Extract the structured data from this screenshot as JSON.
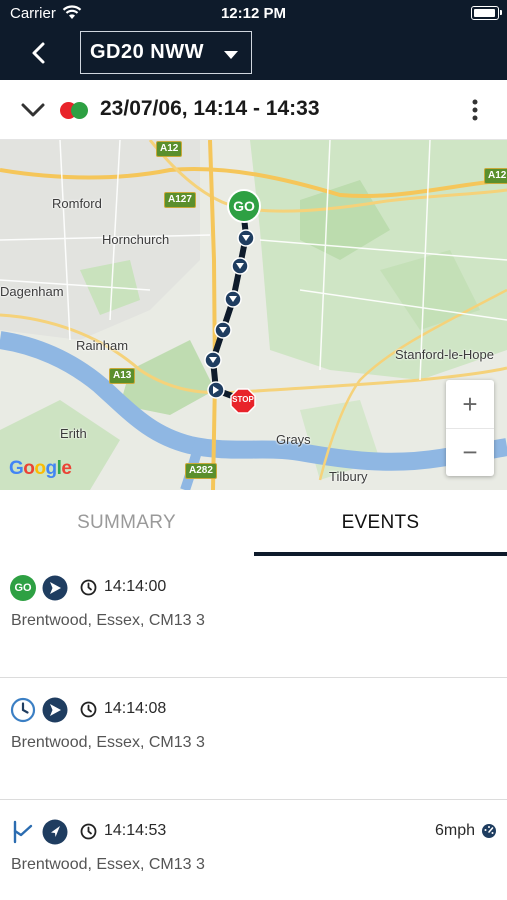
{
  "status_bar": {
    "carrier": "Carrier",
    "time": "12:12 PM"
  },
  "nav": {
    "vehicle": "GD20 NWW"
  },
  "trip": {
    "title": "23/07/06, 14:14 - 14:33"
  },
  "map": {
    "labels": {
      "romford": "Romford",
      "hornchurch": "Hornchurch",
      "dagenham": "Dagenham",
      "rainham": "Rainham",
      "erith": "Erith",
      "grays": "Grays",
      "tilbury": "Tilbury",
      "stanford": "Stanford-le-Hope"
    },
    "roads": {
      "a12": "A12",
      "a127": "A127",
      "a13": "A13",
      "a282": "A282",
      "a12_right": "A12"
    },
    "start_marker": "GO",
    "end_marker": "STOP",
    "attribution": "Google",
    "zoom_in": "+",
    "zoom_out": "−"
  },
  "tabs": {
    "summary": "SUMMARY",
    "events": "EVENTS"
  },
  "events": [
    {
      "icon1": "go-icon",
      "icon2": "heading-icon",
      "icon1_text": "GO",
      "time": "14:14:00",
      "address": "Brentwood, Essex, CM13 3",
      "speed": ""
    },
    {
      "icon1": "clock-outline-icon",
      "icon2": "heading-icon",
      "time": "14:14:08",
      "address": "Brentwood, Essex, CM13 3",
      "speed": ""
    },
    {
      "icon1": "waypoint-flag-icon",
      "icon2": "navigation-icon",
      "time": "14:14:53",
      "address": "Brentwood, Essex, CM13 3",
      "speed": "6mph"
    }
  ],
  "colors": {
    "header": "#0e1b2b",
    "go": "#2ea043",
    "stop": "#e8232a",
    "route": "#0e1b2b",
    "accent": "#1f4e79"
  }
}
